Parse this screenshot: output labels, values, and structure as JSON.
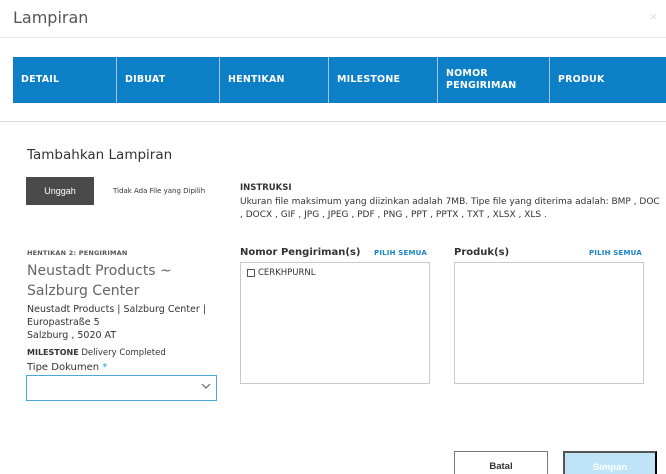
{
  "dialog": {
    "title": "Lampiran",
    "close_glyph": "×"
  },
  "tabs": [
    {
      "label": "DETAIL"
    },
    {
      "label": "DIBUAT"
    },
    {
      "label": "HENTIKAN"
    },
    {
      "label": "MILESTONE"
    },
    {
      "label": "NOMOR\nPENGIRIMAN"
    },
    {
      "label": "PRODUK"
    }
  ],
  "upload": {
    "section_title": "Tambahkan Lampiran",
    "button_label": "Unggah",
    "no_file_text": "Tidak Ada File yang Dipilih"
  },
  "instructions": {
    "heading": "INSTRUKSI",
    "text": "Ukuran file maksimum yang diizinkan adalah 7MB. Tipe file yang diterima adalah: BMP , DOC , DOCX , GIF , JPG , JPEG , PDF , PNG , PPT , PPTX , TXT , XLSX , XLS ."
  },
  "stop": {
    "label": "HENTIKAN 2:  PENGIRIMAN",
    "name": "Neustadt Products ~ Salzburg Center",
    "address_line1": "Neustadt Products | Salzburg Center |",
    "address_line2": "Europastraße 5",
    "address_line3": "Salzburg , 5020 AT",
    "milestone_label": "MILESTONE",
    "milestone_value": "Delivery Completed",
    "doc_type_label": "Tipe Dokumen",
    "required_mark": "*",
    "doc_type_value": ""
  },
  "shipments": {
    "heading": "Nomor Pengiriman(s)",
    "select_all": "PILIH SEMUA",
    "items": [
      "CERKHPURNL"
    ]
  },
  "products": {
    "heading": "Produk(s)",
    "select_all": "PILIH SEMUA",
    "items": []
  },
  "footer": {
    "cancel_label": "Batal",
    "save_label": "Simpan"
  },
  "colors": {
    "tab_bar": "#0d7fc6",
    "link": "#1a85c8",
    "select_border": "#4aa8dc",
    "save_disabled": "#bfe4f7"
  }
}
